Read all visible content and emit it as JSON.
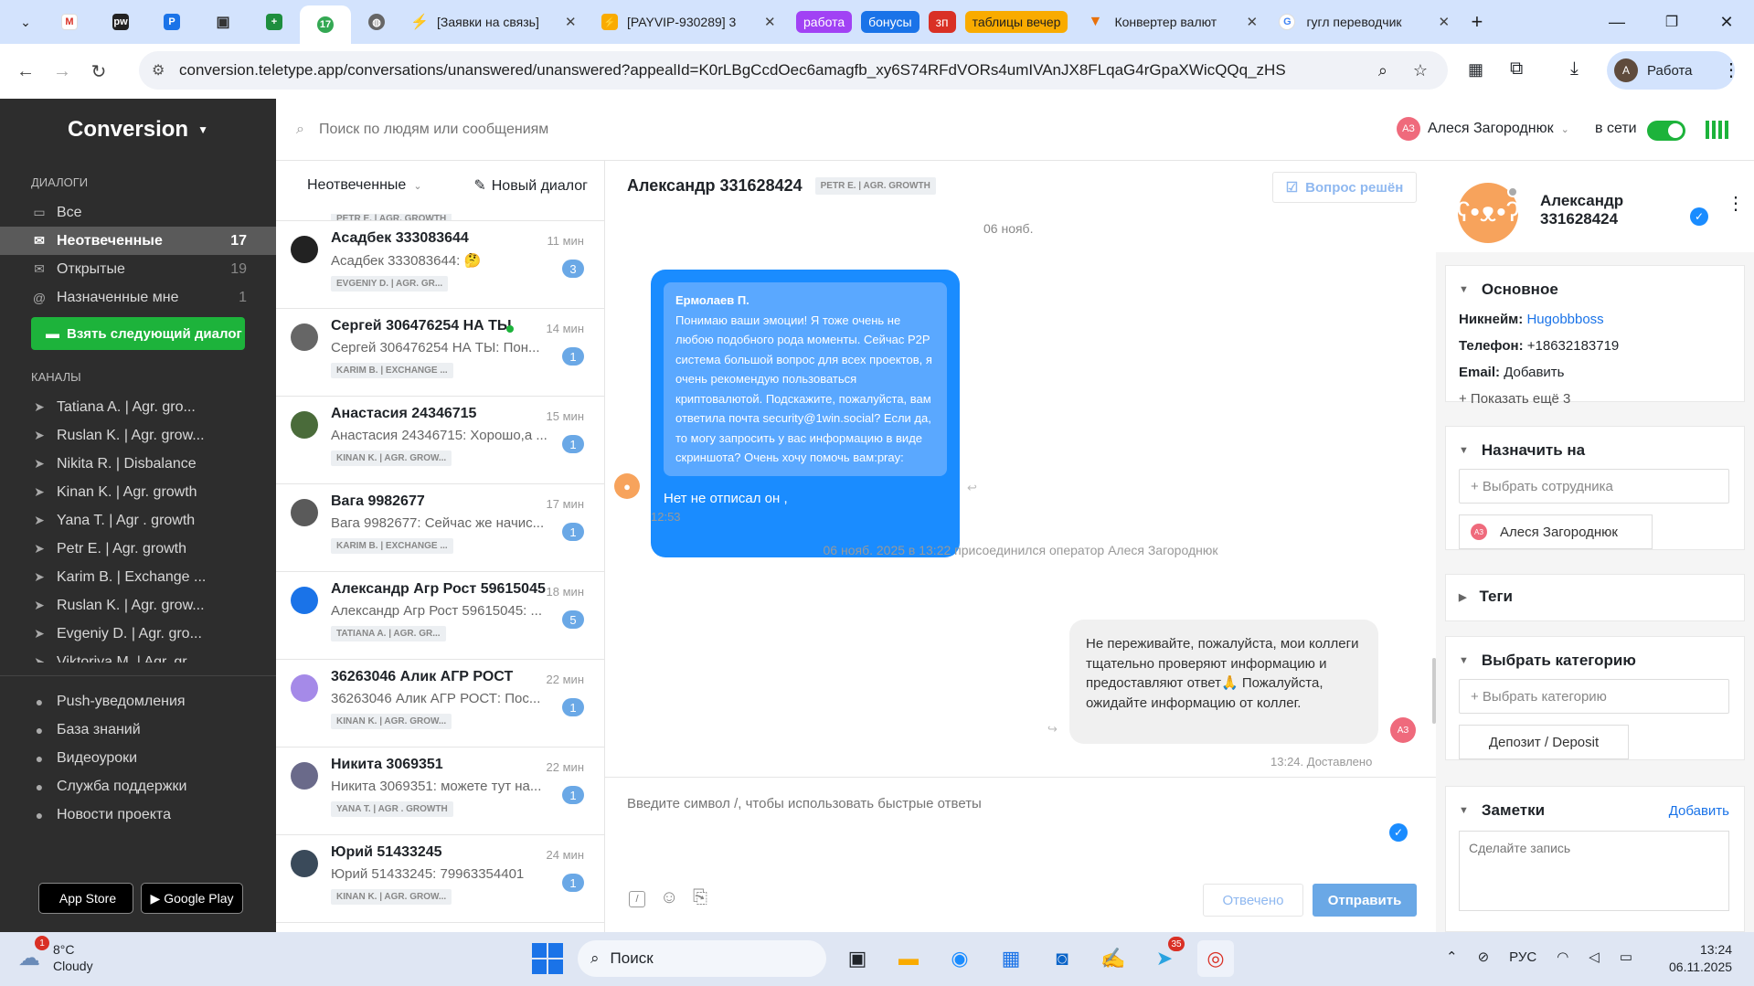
{
  "browser": {
    "tabs": [
      {
        "label": "",
        "icon": "gmail-icon"
      },
      {
        "label": "",
        "icon": "pw-icon"
      },
      {
        "label": "",
        "icon": "p-icon"
      },
      {
        "label": "",
        "icon": "robot-icon"
      },
      {
        "label": "",
        "icon": "sheets-icon"
      },
      {
        "label": "",
        "icon": "teletype-icon",
        "active": true
      },
      {
        "label": "",
        "icon": "globe-icon"
      },
      {
        "label": "[Заявки на связь]",
        "icon": "bolt-icon"
      },
      {
        "label": "[PAYVIP-930289] 3",
        "icon": "lightning-icon"
      }
    ],
    "pills": [
      {
        "label": "работа",
        "color": "#a142f4",
        "text": "#fff"
      },
      {
        "label": "бонусы",
        "color": "#1a73e8",
        "text": "#fff"
      },
      {
        "label": "зп",
        "color": "#d93025",
        "text": "#fff"
      },
      {
        "label": "таблицы вечер",
        "color": "#f9ab00",
        "text": "#1f1f1f"
      }
    ],
    "tabs_right": [
      {
        "label": "Конвертер валют",
        "icon": "v-icon"
      },
      {
        "label": "гугл переводчик",
        "icon": "google-icon"
      }
    ],
    "url": "conversion.teletype.app/conversations/unanswered/unanswered?appealId=K0rLBgCcdOec6amagfb_xy6S74RFdVORs4umIVAnJX8FLqaG4rGpaXWicQQq_zHS",
    "profile_label": "Работа",
    "profile_initial": "A"
  },
  "app": {
    "brand": "Conversion",
    "search_placeholder": "Поиск по людям или сообщениям",
    "operator_initials": "АЗ",
    "operator_name": "Алеся Загороднюк",
    "status_label": "в сети"
  },
  "sidebar": {
    "dialogs_header": "ДИАЛОГИ",
    "dialogs": [
      {
        "label": "Все",
        "count": ""
      },
      {
        "label": "Неотвеченные",
        "count": "17",
        "active": true
      },
      {
        "label": "Открытые",
        "count": "19"
      },
      {
        "label": "Назначенные мне",
        "count": "1"
      }
    ],
    "take_next": "Взять следующий диалог",
    "channels_header": "КАНАЛЫ",
    "channels": [
      "Tatiana A. | Agr. gro...",
      "Ruslan K. | Agr. grow...",
      "Nikita R. | Disbalance",
      "Kinan K. | Agr. growth",
      "Yana T. | Agr . growth",
      "Petr E. | Agr. growth",
      "Karim B. | Exchange ...",
      "Ruslan K. | Agr. grow...",
      "Evgeniy D. | Agr. gro...",
      "Viktoriya M. | Agr. gr..."
    ],
    "links": [
      {
        "label": "Push-уведомления",
        "icon": "bell-icon"
      },
      {
        "label": "База знаний",
        "icon": "book-icon"
      },
      {
        "label": "Видеоуроки",
        "icon": "play-icon"
      },
      {
        "label": "Служба поддержки",
        "icon": "support-icon"
      },
      {
        "label": "Новости проекта",
        "icon": "news-icon"
      }
    ],
    "app_store": "App Store",
    "google_play": "Google Play"
  },
  "list": {
    "filter_label": "Неотвеченные",
    "new_dialog": "Новый диалог",
    "top_tag": "PETR E. | AGR. GROWTH",
    "items": [
      {
        "name": "Асадбек 333083644",
        "time": "11 мин",
        "preview": "Асадбек 333083644: 🤔",
        "badge": "3",
        "tag": "EVGENIY D. | AGR. GR...",
        "color": "#222"
      },
      {
        "name": "Сергей 306476254 НА ТЫ",
        "time": "14 мин",
        "preview": "Сергей 306476254 НА ТЫ: Пон...",
        "badge": "1",
        "tag": "KARIM B. | EXCHANGE ...",
        "color": "#666",
        "online": true
      },
      {
        "name": "Анастасия 24346715",
        "time": "15 мин",
        "preview": "Анастасия 24346715: Хорошо,а ...",
        "badge": "1",
        "tag": "KINAN K. | AGR. GROW...",
        "color": "#4a6b3a"
      },
      {
        "name": "Вага 9982677",
        "time": "17 мин",
        "preview": "Вага 9982677: Сейчас же начис...",
        "badge": "1",
        "tag": "KARIM B. | EXCHANGE ...",
        "color": "#5a5a5a"
      },
      {
        "name": "Александр Агр Рост 59615045",
        "time": "18 мин",
        "preview": "Александр Агр Рост 59615045: ...",
        "badge": "5",
        "tag": "TATIANA A. | AGR. GR...",
        "color": "#1a73e8"
      },
      {
        "name": "36263046 Алик АГР РОСТ",
        "time": "22 мин",
        "preview": "36263046 Алик АГР РОСТ: Пос...",
        "badge": "1",
        "tag": "KINAN K. | AGR. GROW...",
        "color": "#a58ae8"
      },
      {
        "name": "Никита 3069351",
        "time": "22 мин",
        "preview": "Никита 3069351: можете тут на...",
        "badge": "1",
        "tag": "YANA T. | AGR . GROWTH",
        "color": "#6a6a8a"
      },
      {
        "name": "Юрий 51433245",
        "time": "24 мин",
        "preview": "Юрий 51433245: 79963354401",
        "badge": "1",
        "tag": "KINAN K. | AGR. GROW...",
        "color": "#3a4a5a"
      }
    ]
  },
  "chat": {
    "title": "Александр 331628424",
    "tag": "PETR E. | AGR. GROWTH",
    "resolve": "Вопрос решён",
    "date_label": "06 нояб.",
    "quote_author": "Ермолаев П.",
    "quote_text": "Понимаю ваши эмоции! Я тоже очень не любою подобного рода моменты. Сейчас P2P система большой вопрос для всех проектов, я очень рекомендую пользоваться криптовалютой. Подскажите, пожалуйста, вам ответила почта security@1win.social? Если да, то могу запросить у вас информацию в виде скриншота? Очень хочу помочь вам:pray:",
    "in_message": "Нет не отписал он ,",
    "in_time": "12:53",
    "system_message": "06 нояб. 2025 в 13:22 присоединился оператор Алеся Загороднюк",
    "out_message": "Не переживайте, пожалуйста, мои коллеги тщательно проверяют информацию и предоставляют ответ🙏 Пожалуйста, ожидайте информацию от коллег.",
    "out_initials": "АЗ",
    "out_status": "13:24. Доставлено",
    "composer_placeholder": "Введите символ /, чтобы использовать быстрые ответы",
    "answered": "Отвечено",
    "send": "Отправить"
  },
  "contact": {
    "name": "Александр 331628424",
    "main_title": "Основное",
    "nickname_label": "Никнейм:",
    "nickname": "Hugobbboss",
    "phone_label": "Телефон:",
    "phone": "+18632183719",
    "email_label": "Email:",
    "email_action": "Добавить",
    "show_more": "+ Показать ещё 3",
    "assign_title": "Назначить на",
    "assign_placeholder": "+ Выбрать сотрудника",
    "assignee_initials": "АЗ",
    "assignee": "Алеся Загороднюк",
    "tags_title": "Теги",
    "category_title": "Выбрать категорию",
    "category_placeholder": "+ Выбрать категорию",
    "category_value": "Депозит / Deposit",
    "notes_title": "Заметки",
    "notes_add": "Добавить",
    "notes_placeholder": "Сделайте запись"
  },
  "taskbar": {
    "weather_temp": "8°C",
    "weather_desc": "Cloudy",
    "weather_badge": "1",
    "search": "Поиск",
    "telegram_badge": "35",
    "lang": "РУС",
    "time": "13:24",
    "date": "06.11.2025"
  }
}
